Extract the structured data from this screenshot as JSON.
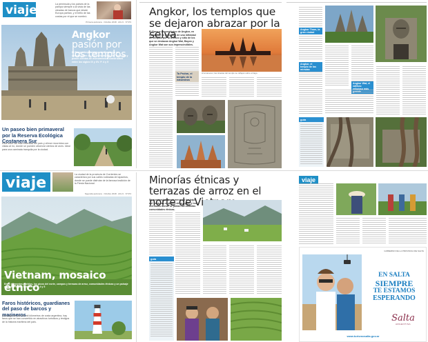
{
  "colors": {
    "brand_blue": "#1f8fc6",
    "accent_green": "#7bb34a",
    "ad_blue": "#1c7fc1"
  },
  "cover1": {
    "logo": "viaje",
    "teaser": "La península y los países de la pampa siempre a la vista de las oleadas de barcos que desde Europa partían, y el brillo de las costas por el que se nombró.",
    "edition": "Primera quincena · Octubre 2018 · Año 9 · N°473",
    "main_title_1": "Angkor",
    "main_title_2": " pasión por los templos",
    "main_sub": "El Parque Arqueológico de Camboya se distribuye en un territorio de 400 km² de selva y posee cientos de monumentos construidos entre los siglos IX y XV. P. 4 y 5",
    "second_title": "Un paseo bien primaveral por la Reserva Ecológica Costanera Sur",
    "second_body": "Está entre las más extensas del país y ofrece recorridos con vistas al río, donde se pueden observar cientos de aves. Ideal para una caminata tranquila por la ciudad."
  },
  "spread1": {
    "title": "Angkor, los templos que se dejaron abrazar por la selva",
    "deck": "El Parque Arqueológico de Angkor, en Camboya, se compone de una infinidad de templos por la Unesco y sitio de los que se destacan Angkor Wat, Bayon y Angkor Wat son sus imprescindibles.",
    "caption_1": "Al amanecer, las siluetas del templo se reflejan sobre el lago.",
    "kicker": "Ta Prohm, el templo de la naturaleza",
    "side_kicker_1": "Angkor Thom, la gran ciudad",
    "side_kicker_2": "Angkor, el templo de las miradas",
    "side_kicker_3": "Angkor Wat, el edificio religioso más grande",
    "info_label": "guía"
  },
  "cover2": {
    "logo": "viaje",
    "teaser": "La ciudad de la provincia de Corrientes se caracteriza por sus calles rodeadas de lapachos, donde se puede disfrutar de la famosa tradición de la Fiesta Nacional.",
    "edition": "Segunda quincena · Octubre 2018 · Año 9 · N°474",
    "main_title": "Vietnam, mosaico étnico",
    "main_sub": "Entre diferentes pueblos, los picos del norte, campos y terrazas de arroz, comunidades étnicas y un paisaje que no te dejará indiferente. P. 4 y 5",
    "second_title": "Faros históricos, guardianes del paso de barcos y marineros",
    "second_body": "A lo largo de más de mil kilómetros de costa argentina, hay faros que se han convertido en atractivos turísticos y testigos de la historia marítima del país."
  },
  "spread2": {
    "title": "Minorías étnicas y terrazas de arroz en el norte de Vietnam",
    "deck": "Se acercan los aventureros en los bajos del Sapa, las ciudades de la región y los mercados donde se juntan las distintas comunidades étnicas.",
    "logo": "viaje",
    "info_label": "guía",
    "ad_line_1": "EN SALTA",
    "ad_line_2": "SIEMPRE",
    "ad_line_3": "TE ESTAMOS",
    "ad_line_4": "ESPERANDO",
    "ad_brand": "Salta",
    "ad_brand_sub": "ARGENTINA",
    "ad_url": "www.turismosalta.gov.ar",
    "ad_gov": "GOBIERNO DE LA PROVINCIA DE SALTA"
  }
}
